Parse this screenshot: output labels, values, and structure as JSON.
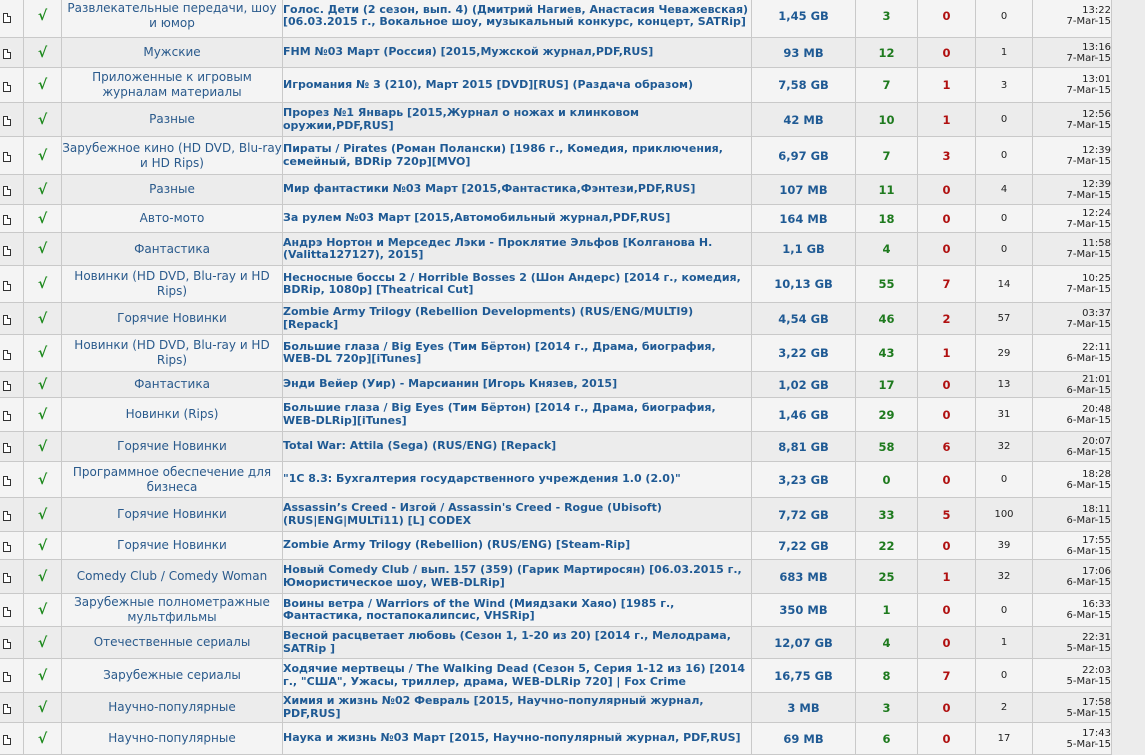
{
  "rows": [
    {
      "category": "Развлекательные передачи, шоу и юмор",
      "title": "Голос. Дети (2 сезон, вып. 4) (Дмитрий Нагиев, Анастасия Чеважевская) [06.03.2015 г., Вокальное шоу, музыкальный конкурс, концерт, SATRip]",
      "size": "1,45 GB",
      "seeders": "3",
      "leechers": "0",
      "downloads": "0",
      "time": "13:22",
      "date": "7-Mar-15"
    },
    {
      "category": "Мужские",
      "title": "FHM №03 Март (Россия) [2015,Мужской журнал,PDF,RUS]",
      "size": "93 MB",
      "seeders": "12",
      "leechers": "0",
      "downloads": "1",
      "time": "13:16",
      "date": "7-Mar-15"
    },
    {
      "category": "Приложенные к игровым журналам материалы",
      "title": "Игромания № 3 (210), Март 2015 [DVD][RUS] (Раздача образом)",
      "size": "7,58 GB",
      "seeders": "7",
      "leechers": "1",
      "downloads": "3",
      "time": "13:01",
      "date": "7-Mar-15"
    },
    {
      "category": "Разные",
      "title": "Прорез №1 Январь [2015,Журнал о ножах и клинковом оружии,PDF,RUS]",
      "size": "42 MB",
      "seeders": "10",
      "leechers": "1",
      "downloads": "0",
      "time": "12:56",
      "date": "7-Mar-15"
    },
    {
      "category": "Зарубежное кино (HD DVD, Blu-ray и HD Rips)",
      "title": "Пираты / Pirates (Роман Полански) [1986 г., Комедия, приключения, семейный, BDRip 720p][MVO]",
      "size": "6,97 GB",
      "seeders": "7",
      "leechers": "3",
      "downloads": "0",
      "time": "12:39",
      "date": "7-Mar-15"
    },
    {
      "category": "Разные",
      "title": "Мир фантастики №03 Март [2015,Фантастика,Фэнтези,PDF,RUS]",
      "size": "107 MB",
      "seeders": "11",
      "leechers": "0",
      "downloads": "4",
      "time": "12:39",
      "date": "7-Mar-15"
    },
    {
      "category": "Авто-мото",
      "title": "За рулем №03 Март [2015,Автомобильный журнал,PDF,RUS]",
      "size": "164 MB",
      "seeders": "18",
      "leechers": "0",
      "downloads": "0",
      "time": "12:24",
      "date": "7-Mar-15"
    },
    {
      "category": "Фантастика",
      "title": "Андрэ Нортон и Мерседес Лэки - Проклятие Эльфов [Колганова Н. (Valitta127127), 2015]",
      "size": "1,1 GB",
      "seeders": "4",
      "leechers": "0",
      "downloads": "0",
      "time": "11:58",
      "date": "7-Mar-15"
    },
    {
      "category": "Новинки (HD DVD, Blu-ray и HD Rips)",
      "title": "Несносные боссы 2 / Horrible Bosses 2 (Шон Андерс) [2014 г., комедия, BDRip, 1080p] [Theatrical Cut]",
      "size": "10,13 GB",
      "seeders": "55",
      "leechers": "7",
      "downloads": "14",
      "time": "10:25",
      "date": "7-Mar-15"
    },
    {
      "category": "Горячие Новинки",
      "title": "Zombie Army Trilogy (Rebellion Developments) (RUS/ENG/MULTI9) [Repack]",
      "size": "4,54 GB",
      "seeders": "46",
      "leechers": "2",
      "downloads": "57",
      "time": "03:37",
      "date": "7-Mar-15"
    },
    {
      "category": "Новинки (HD DVD, Blu-ray и HD Rips)",
      "title": "Большие глаза / Big Eyes (Тим Бёртон) [2014 г., Драма, биография, WEB-DL 720p][iTunes]",
      "size": "3,22 GB",
      "seeders": "43",
      "leechers": "1",
      "downloads": "29",
      "time": "22:11",
      "date": "6-Mar-15"
    },
    {
      "category": "Фантастика",
      "title": "Энди Вейер (Уир) - Марсианин [Игорь Князев, 2015]",
      "size": "1,02 GB",
      "seeders": "17",
      "leechers": "0",
      "downloads": "13",
      "time": "21:01",
      "date": "6-Mar-15"
    },
    {
      "category": "Новинки (Rips)",
      "title": "Большие глаза / Big Eyes (Тим Бёртон) [2014 г., Драма, биография, WEB-DLRip][iTunes]",
      "size": "1,46 GB",
      "seeders": "29",
      "leechers": "0",
      "downloads": "31",
      "time": "20:48",
      "date": "6-Mar-15"
    },
    {
      "category": "Горячие Новинки",
      "title": "Total War: Attila (Sega) (RUS/ENG) [Repack]",
      "size": "8,81 GB",
      "seeders": "58",
      "leechers": "6",
      "downloads": "32",
      "time": "20:07",
      "date": "6-Mar-15"
    },
    {
      "category": "Программное обеспечение для бизнеса",
      "title": "\"1С 8.3: Бухгалтерия государственного учреждения 1.0 (2.0)\"",
      "size": "3,23 GB",
      "seeders": "0",
      "leechers": "0",
      "downloads": "0",
      "time": "18:28",
      "date": "6-Mar-15"
    },
    {
      "category": "Горячие Новинки",
      "title": "Assassin’s Creed - Изгой / Assassin's Creed - Rogue (Ubisoft) (RUS|ENG|MULTi11) [L] CODEX",
      "size": "7,72 GB",
      "seeders": "33",
      "leechers": "5",
      "downloads": "100",
      "time": "18:11",
      "date": "6-Mar-15"
    },
    {
      "category": "Горячие Новинки",
      "title": "Zombie Army Trilogy (Rebellion) (RUS/ENG) [Steam-Rip]",
      "size": "7,22 GB",
      "seeders": "22",
      "leechers": "0",
      "downloads": "39",
      "time": "17:55",
      "date": "6-Mar-15"
    },
    {
      "category": "Comedy Club / Comedy Woman",
      "title": "Новый Comedy Club / вып. 157 (359) (Гарик Мартиросян) [06.03.2015 г., Юмористическое шоу, WEB-DLRip]",
      "size": "683 MB",
      "seeders": "25",
      "leechers": "1",
      "downloads": "32",
      "time": "17:06",
      "date": "6-Mar-15"
    },
    {
      "category": "Зарубежные полнометражные мультфильмы",
      "title": "Воины ветра / Warriors of the Wind (Миядзаки Хаяо) [1985 г., Фантастика, постапокалипсис, VHSRip]",
      "size": "350 MB",
      "seeders": "1",
      "leechers": "0",
      "downloads": "0",
      "time": "16:33",
      "date": "6-Mar-15"
    },
    {
      "category": "Отечественные сериалы",
      "title": "Весной расцветает любовь (Сезон 1, 1-20 из 20) [2014 г., Мелодрама, SATRip ]",
      "size": "12,07 GB",
      "seeders": "4",
      "leechers": "0",
      "downloads": "1",
      "time": "22:31",
      "date": "5-Mar-15"
    },
    {
      "category": "Зарубежные сериалы",
      "title": "Ходячие мертвецы / The Walking Dead (Сезон 5, Серия 1-12 из 16) [2014 г., \"США\", Ужасы, триллер, драма, WEB-DLRip 720] | Fox Crime",
      "size": "16,75 GB",
      "seeders": "8",
      "leechers": "7",
      "downloads": "0",
      "time": "22:03",
      "date": "5-Mar-15"
    },
    {
      "category": "Научно-популярные",
      "title": "Химия и жизнь №02 Февраль [2015, Научно-популярный журнал, PDF,RUS]",
      "size": "3 MB",
      "seeders": "3",
      "leechers": "0",
      "downloads": "2",
      "time": "17:58",
      "date": "5-Mar-15"
    },
    {
      "category": "Научно-популярные",
      "title": "Наука и жизнь №03 Март [2015, Научно-популярный журнал, PDF,RUS]",
      "size": "69 MB",
      "seeders": "6",
      "leechers": "0",
      "downloads": "17",
      "time": "17:43",
      "date": "5-Mar-15"
    }
  ],
  "row_heights": [
    42,
    29,
    34,
    33,
    37,
    29,
    27,
    32,
    36,
    31,
    36,
    25,
    33,
    29,
    35,
    33,
    27,
    33,
    32,
    31,
    33,
    29,
    31
  ]
}
